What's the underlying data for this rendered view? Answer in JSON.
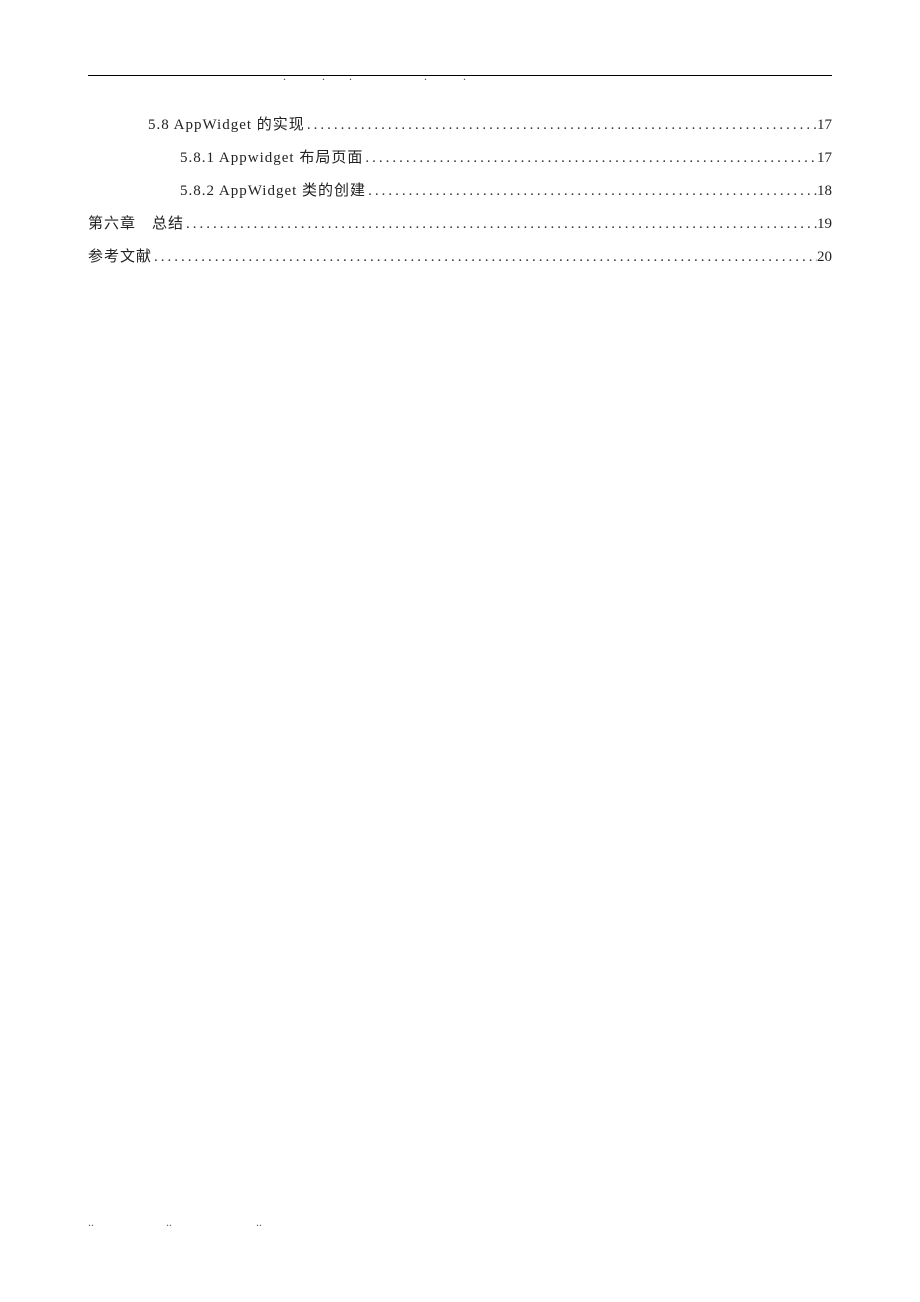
{
  "toc": {
    "entries": [
      {
        "indent": 1,
        "label": "5.8 AppWidget 的实现",
        "page": "17"
      },
      {
        "indent": 2,
        "label": "5.8.1 Appwidget 布局页面",
        "page": "17"
      },
      {
        "indent": 2,
        "label": "5.8.2 AppWidget 类的创建",
        "page": "18"
      },
      {
        "indent": 0,
        "label": "第六章　总结",
        "page": "19"
      },
      {
        "indent": 0,
        "label": "参考文献",
        "page": "20"
      }
    ]
  },
  "header_marks": ".　　　.　　.　　　　　　.　　　.",
  "footer_marks": "..　　　　　　..　　　　　　　.."
}
